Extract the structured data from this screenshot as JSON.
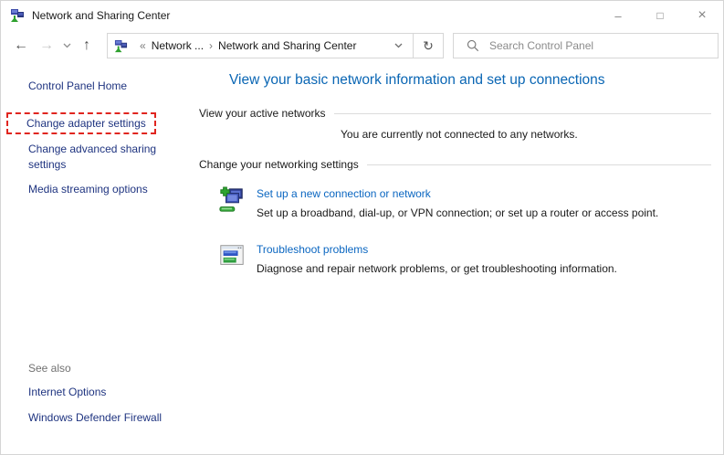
{
  "window": {
    "title": "Network and Sharing Center"
  },
  "icons": {
    "app": "network-computers",
    "minimize": "–",
    "maximize": "□",
    "close": "×",
    "back": "←",
    "forward": "→",
    "up": "↑",
    "refresh": "↻",
    "search": "magnifier",
    "chevron_down": "chevron-down"
  },
  "toolbar": {
    "breadcrumb": {
      "overflow": "«",
      "root": "Network ...",
      "separator": "›",
      "current": "Network and Sharing Center"
    },
    "search": {
      "placeholder": "Search Control Panel",
      "value": ""
    }
  },
  "sidebar": {
    "home": "Control Panel Home",
    "items": [
      {
        "label": "Change adapter settings",
        "highlighted": true
      },
      {
        "label": "Change advanced sharing settings",
        "highlighted": false
      },
      {
        "label": "Media streaming options",
        "highlighted": false
      }
    ],
    "see_also": {
      "header": "See also",
      "items": [
        "Internet Options",
        "Windows Defender Firewall"
      ]
    }
  },
  "main": {
    "heading": "View your basic network information and set up connections",
    "active_networks": {
      "header": "View your active networks",
      "status": "You are currently not connected to any networks."
    },
    "networking_settings": {
      "header": "Change your networking settings",
      "items": [
        {
          "title": "Set up a new connection or network",
          "description": "Set up a broadband, dial-up, or VPN connection; or set up a router or access point."
        },
        {
          "title": "Troubleshoot problems",
          "description": "Diagnose and repair network problems, or get troubleshooting information."
        }
      ]
    }
  },
  "colors": {
    "heading_blue": "#0a66b4",
    "content_link_blue": "#0a66c1",
    "sidebar_link_navy": "#1f3480",
    "highlight_red": "#e0251f",
    "rule_gray": "#dcdcdc",
    "placeholder_gray": "#8b8b8b"
  }
}
